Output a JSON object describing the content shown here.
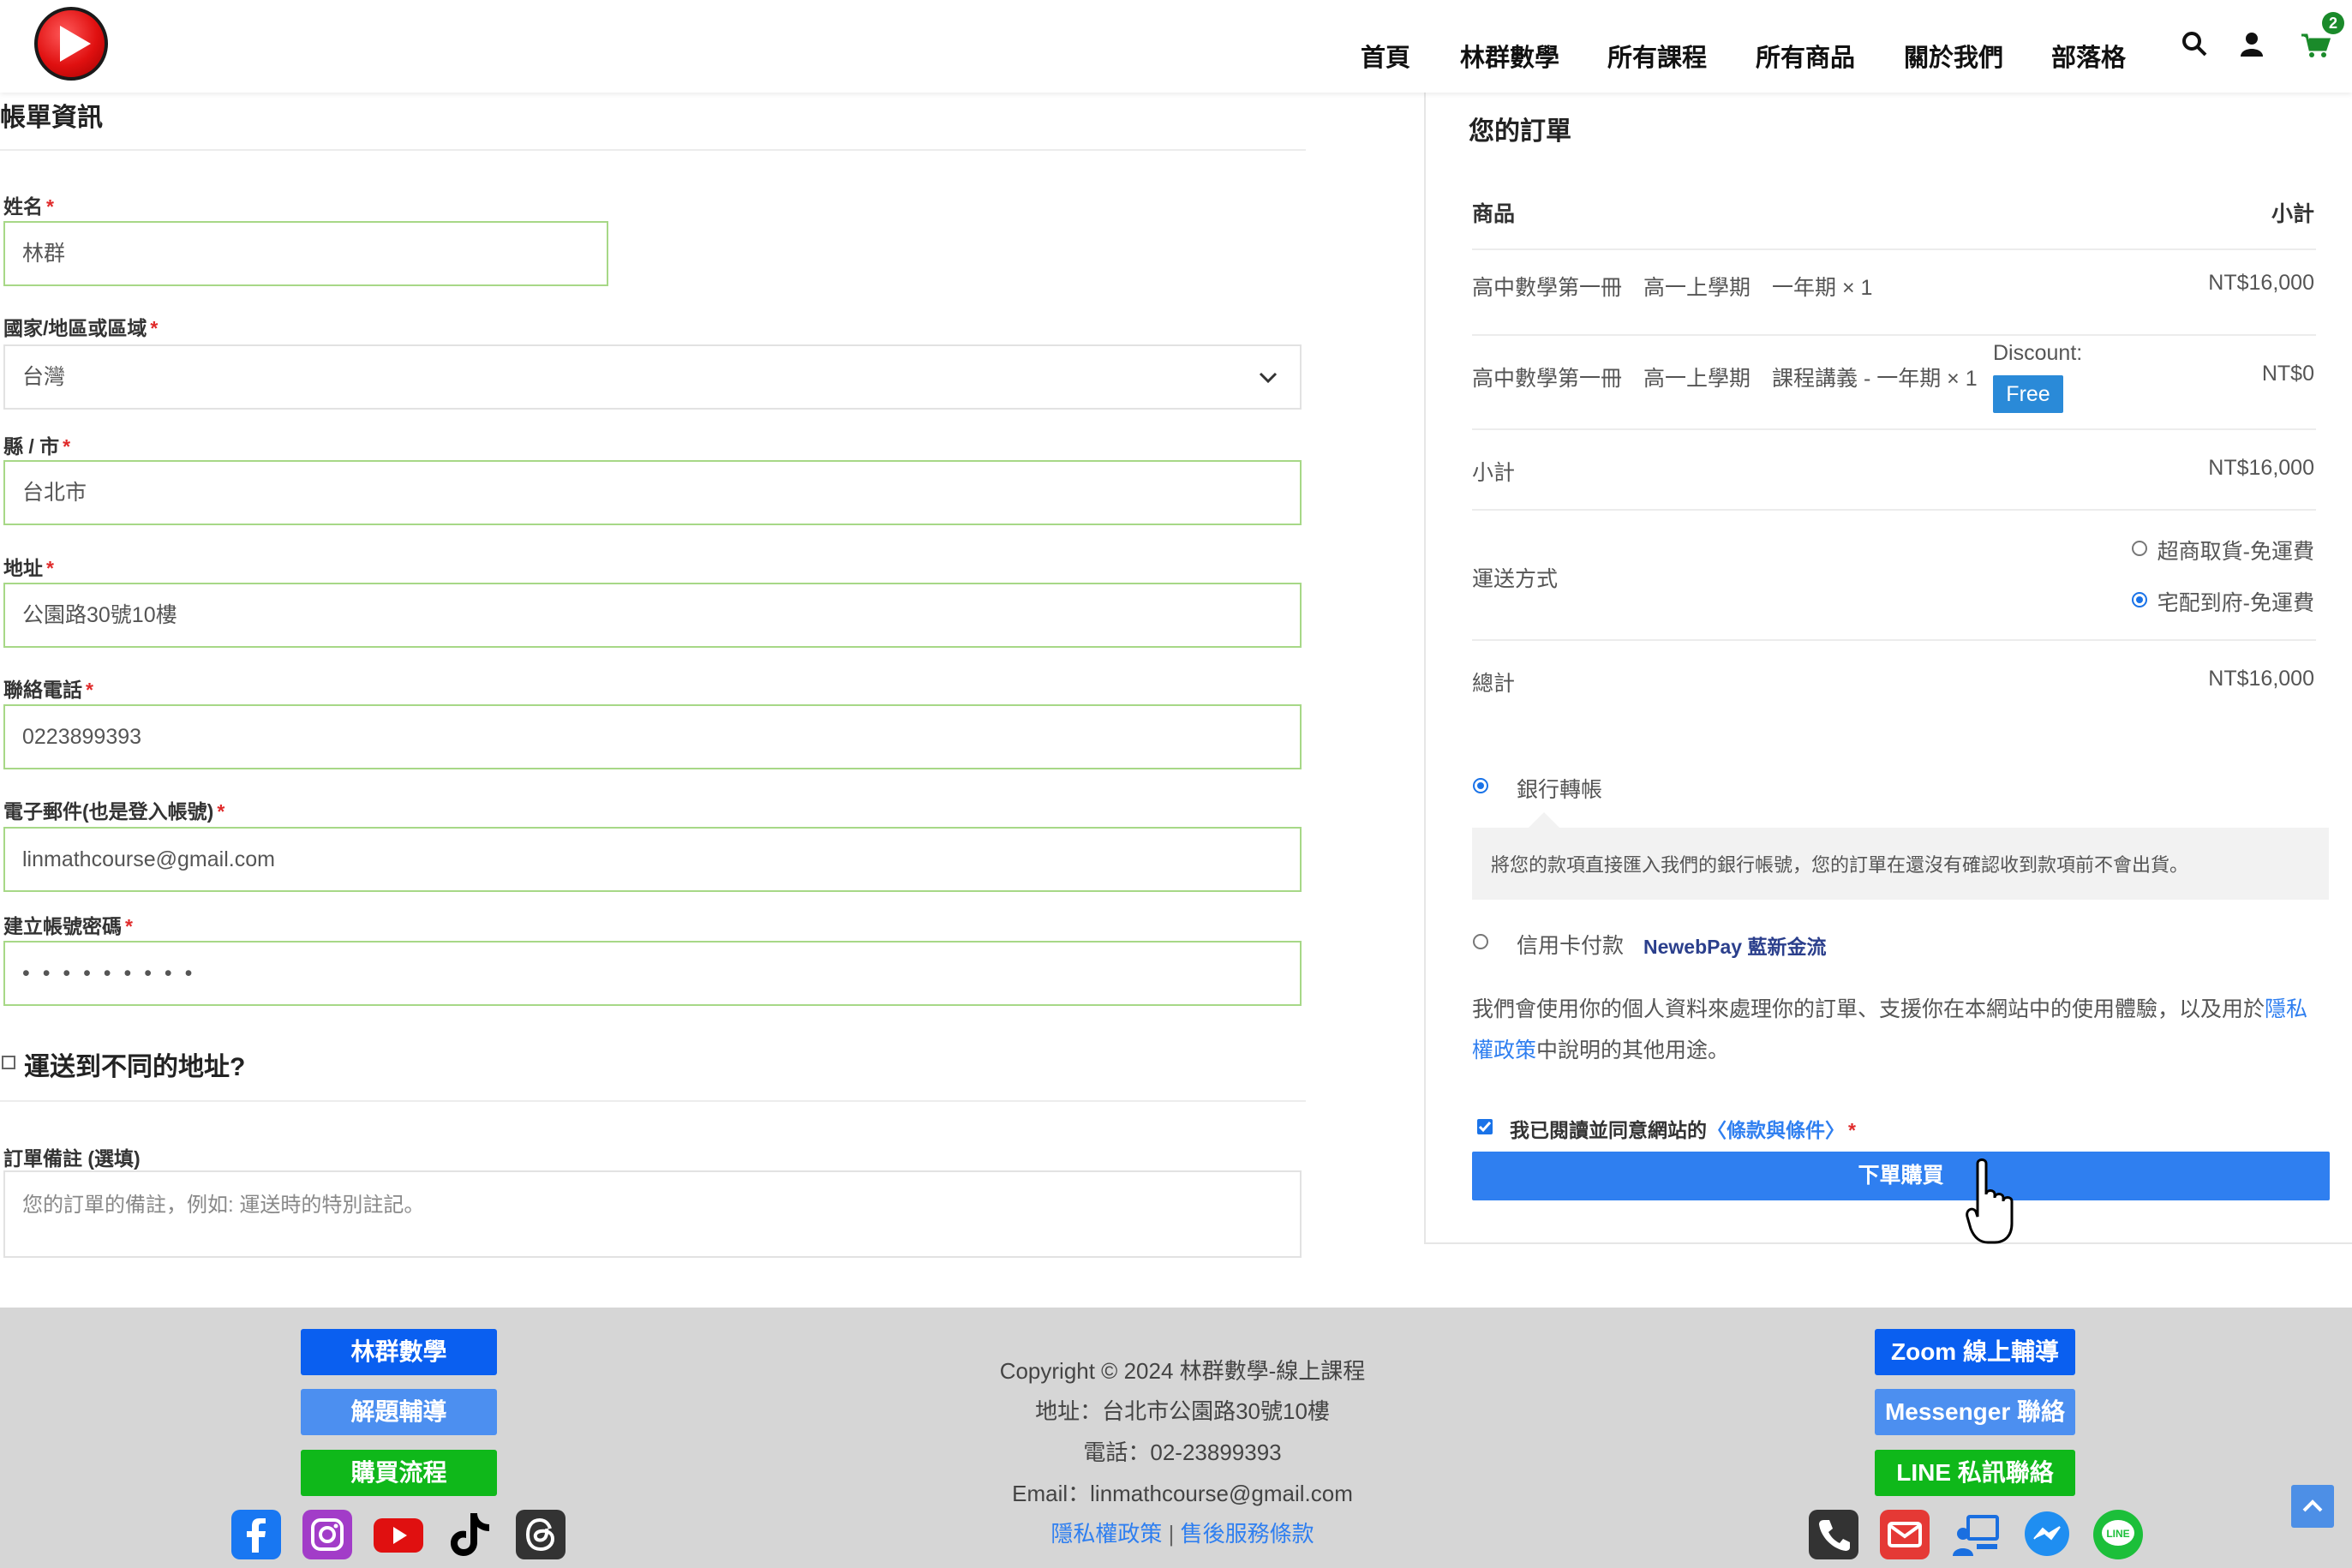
{
  "header": {
    "nav": [
      "首頁",
      "林群數學",
      "所有課程",
      "所有商品",
      "關於我們",
      "部落格"
    ],
    "cart_count": "2",
    "icons": [
      "search-icon",
      "user-icon",
      "cart-icon"
    ]
  },
  "billing": {
    "title": "帳單資訊",
    "fields": [
      {
        "label": "姓名",
        "value": "林群"
      },
      {
        "label": "國家/地區或區域",
        "value": "台灣"
      },
      {
        "label": "縣 / 市",
        "value": "台北市"
      },
      {
        "label": "地址",
        "value": "公園路30號10樓"
      },
      {
        "label": "聯絡電話",
        "value": "0223899393"
      },
      {
        "label": "電子郵件(也是登入帳號)",
        "value": "linmathcourse@gmail.com"
      },
      {
        "label": "建立帳號密碼",
        "value": "• • • • • • • • •"
      }
    ],
    "required_mark": "*",
    "ship_different": "運送到不同的地址?",
    "notes_label": "訂單備註 (選填)",
    "notes_placeholder": "您的訂單的備註，例如: 運送時的特別註記。"
  },
  "order": {
    "title": "您的訂單",
    "col_product": "商品",
    "col_subtotal": "小計",
    "items": [
      {
        "name": "高中數學第一冊　高一上學期　一年期 × 1",
        "price": "NT$16,000"
      },
      {
        "name": "高中數學第一冊　高一上學期　課程講義 - 一年期 × 1",
        "discount_label": "Discount:",
        "badge": "Free",
        "price": "NT$0"
      }
    ],
    "subtotal_label": "小計",
    "subtotal": "NT$16,000",
    "shipping_label": "運送方式",
    "shipping_options": [
      "超商取貨-免運費",
      "宅配到府-免運費"
    ],
    "total_label": "總計",
    "total": "NT$16,000",
    "payment_bank": "銀行轉帳",
    "payment_bank_desc": "將您的款項直接匯入我們的銀行帳號，您的訂單在還沒有確認收到款項前不會出貨。",
    "payment_card": "信用卡付款",
    "payment_card_brand": "NewebPay 藍新金流",
    "privacy_text_1": "我們會使用你的個人資料來處理你的訂單、支援你在本網站中的使用體驗，以及用於",
    "privacy_link_1": "隱私",
    "privacy_link_2": "權政策",
    "privacy_text_2": "中說明的其他用途。",
    "terms_text": "我已閱讀並同意網站的",
    "terms_link": "〈條款與條件〉",
    "place_order": "下單購買"
  },
  "footer": {
    "left_buttons": [
      "林群數學",
      "解題輔導",
      "購買流程"
    ],
    "right_buttons": [
      "Zoom 線上輔導",
      "Messenger 聯絡",
      "LINE 私訊聯絡"
    ],
    "lines": [
      "Copyright © 2024 林群數學-線上課程",
      "地址：台北市公園路30號10樓",
      "電話：02-23899393",
      "Email：linmathcourse@gmail.com"
    ],
    "link_privacy": "隱私權政策",
    "link_sep": "|",
    "link_service": "售後服務條款",
    "colors": {
      "blue": "#0a5ff0",
      "light_blue": "#4c8ff0",
      "green": "#0fb81a"
    }
  }
}
